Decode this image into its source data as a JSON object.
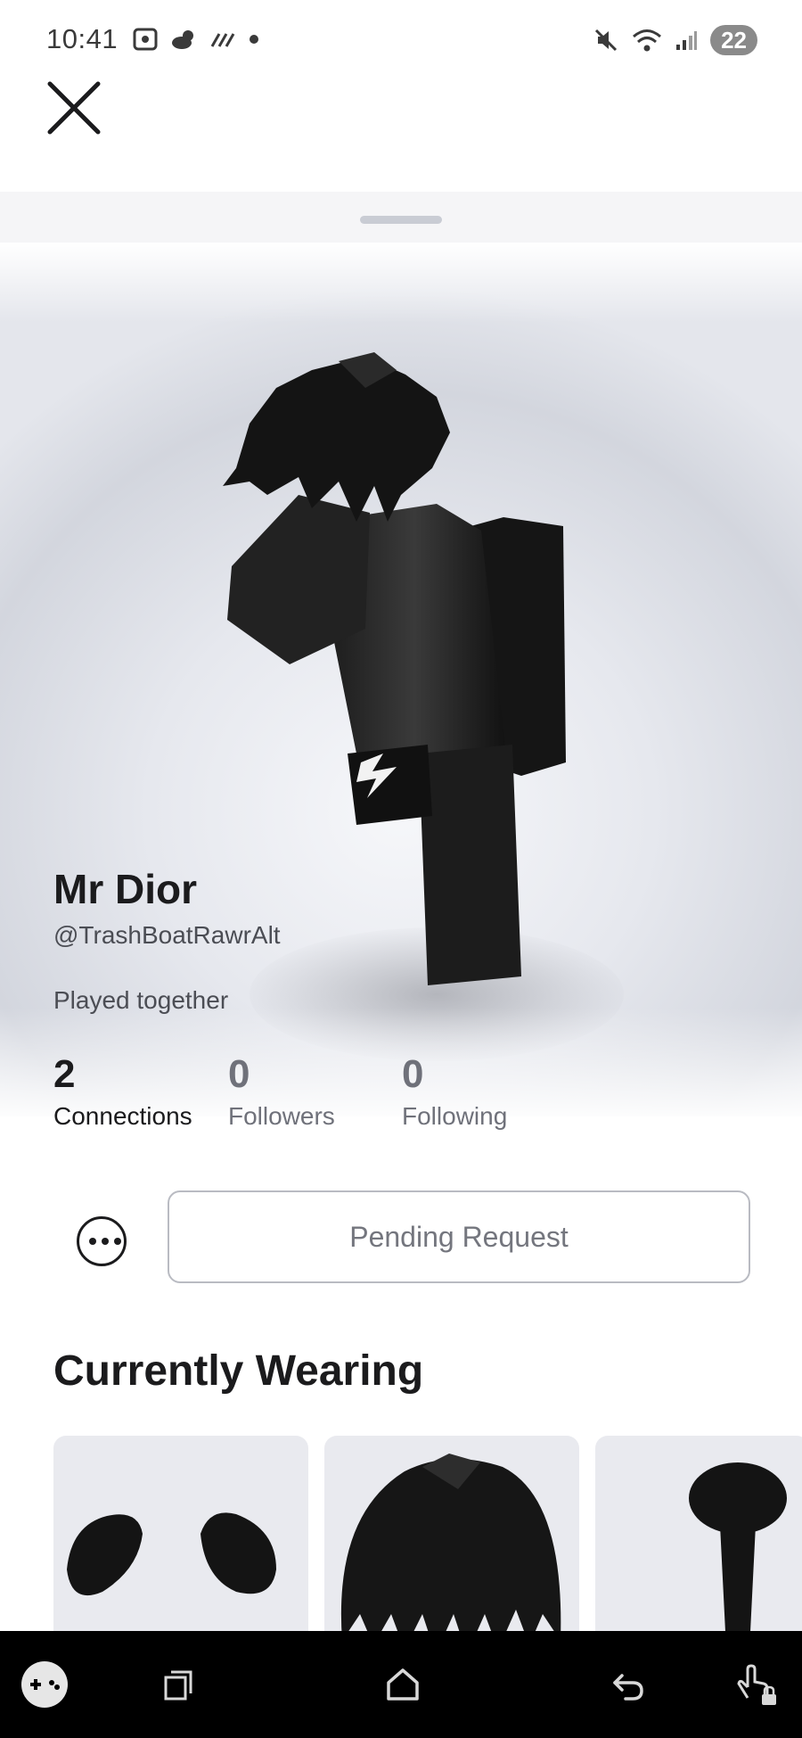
{
  "status_bar": {
    "time": "10:41",
    "battery": "22"
  },
  "profile": {
    "display_name": "Mr Dior",
    "username": "@TrashBoatRawrAlt",
    "relation": "Played together",
    "stats": [
      {
        "value": "2",
        "label": "Connections"
      },
      {
        "value": "0",
        "label": "Followers"
      },
      {
        "value": "0",
        "label": "Following"
      }
    ]
  },
  "actions": {
    "pending_request_label": "Pending Request"
  },
  "wearing": {
    "title": "Currently Wearing"
  },
  "colors": {
    "text_primary": "#1b1b1d",
    "text_secondary": "#6f717a",
    "nav_background": "#000000",
    "card_background": "#e9eaef"
  },
  "icons": {
    "close": "close-icon",
    "more": "more-options-icon",
    "nav": [
      "gamepad-icon",
      "recent-apps-icon",
      "home-icon",
      "back-icon",
      "touch-lock-icon"
    ]
  }
}
